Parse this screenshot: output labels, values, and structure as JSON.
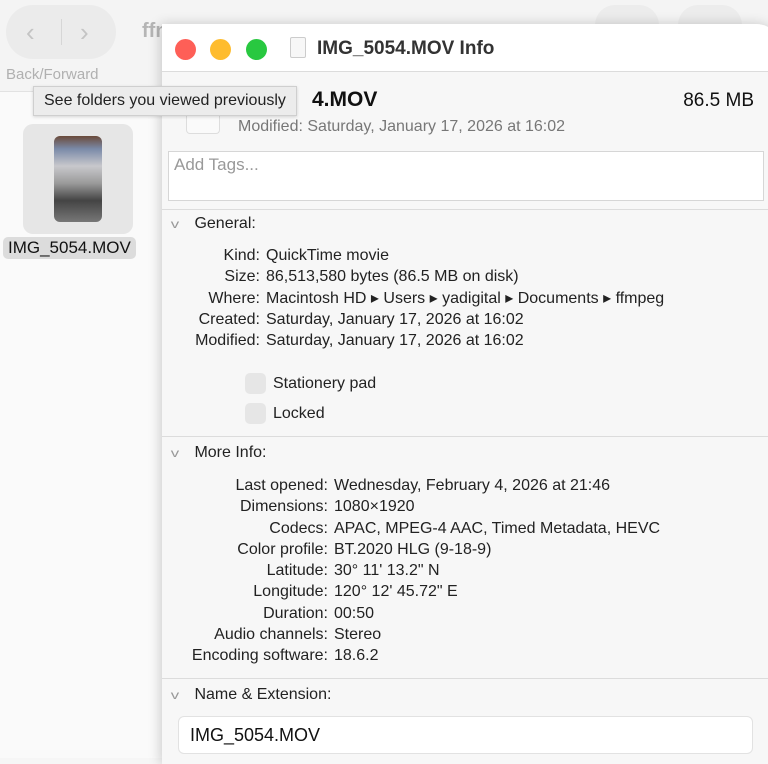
{
  "finder": {
    "back_icon": "chevron-left-icon",
    "forward_icon": "chevron-right-icon",
    "nav_label": "Back/Forward",
    "folder_title": "ffm",
    "tooltip": "See folders you viewed previously",
    "file_label": "IMG_5054.MOV"
  },
  "info": {
    "window_title": "IMG_5054.MOV Info",
    "name_partial": "4.MOV",
    "size": "86.5 MB",
    "modified_line": "Modified: Saturday, January 17, 2026 at 16:02",
    "tags_placeholder": "Add Tags...",
    "general": {
      "title": "General:",
      "rows": [
        {
          "k": "Kind:",
          "v": "QuickTime movie"
        },
        {
          "k": "Size:",
          "v": "86,513,580 bytes (86.5 MB on disk)"
        },
        {
          "k": "Where:",
          "v": "Macintosh HD ▸ Users ▸ yadigital ▸ Documents ▸ ffmpeg"
        },
        {
          "k": "Created:",
          "v": "Saturday, January 17, 2026 at 16:02"
        },
        {
          "k": "Modified:",
          "v": "Saturday, January 17, 2026 at 16:02"
        }
      ],
      "stationery": "Stationery pad",
      "locked": "Locked"
    },
    "more": {
      "title": "More Info:",
      "rows": [
        {
          "k": "Last opened:",
          "v": "Wednesday, February 4, 2026 at 21:46"
        },
        {
          "k": "Dimensions:",
          "v": "1080×1920"
        },
        {
          "k": "Codecs:",
          "v": "APAC, MPEG-4 AAC, Timed Metadata, HEVC"
        },
        {
          "k": "Color profile:",
          "v": "BT.2020 HLG (9-18-9)"
        },
        {
          "k": "Latitude:",
          "v": "30° 11' 13.2\" N"
        },
        {
          "k": "Longitude:",
          "v": "120° 12' 45.72\" E"
        },
        {
          "k": "Duration:",
          "v": "00:50"
        },
        {
          "k": "Audio channels:",
          "v": "Stereo"
        },
        {
          "k": "Encoding software:",
          "v": "18.6.2"
        }
      ]
    },
    "name_ext": {
      "title": "Name & Extension:",
      "value": "IMG_5054.MOV"
    }
  },
  "colors": {
    "close": "#fe5f57",
    "minimize": "#febc2e",
    "zoom": "#28c840"
  }
}
